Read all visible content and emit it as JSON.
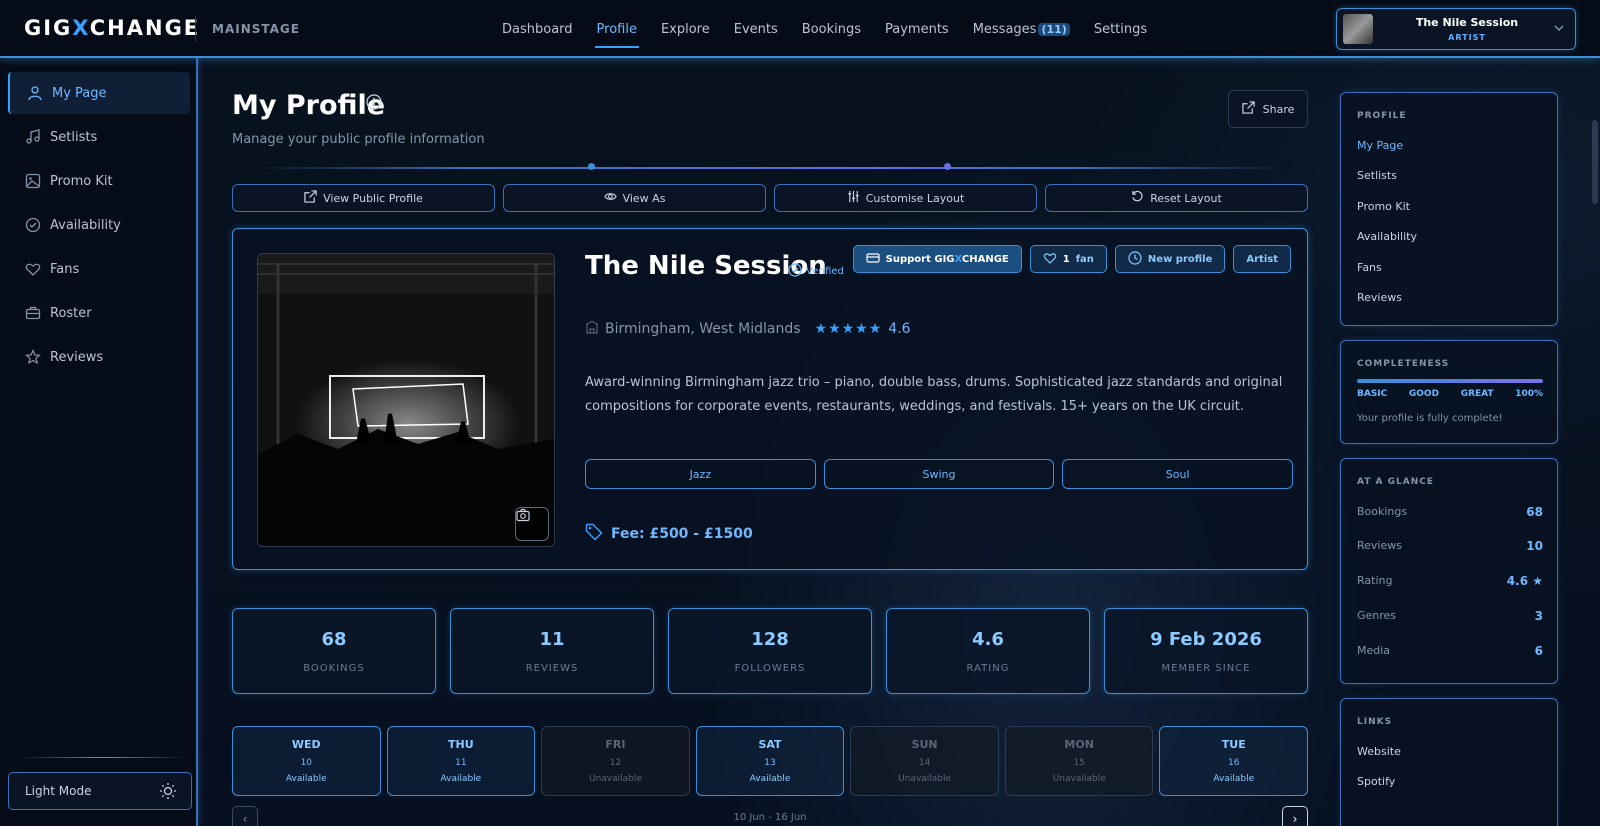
{
  "app": {
    "logo_pre": "GIG",
    "logo_x": "X",
    "logo_post": "CHANGE",
    "section": "MAINSTAGE"
  },
  "nav": [
    {
      "label": "Dashboard"
    },
    {
      "label": "Profile",
      "active": true
    },
    {
      "label": "Explore"
    },
    {
      "label": "Events"
    },
    {
      "label": "Bookings"
    },
    {
      "label": "Payments"
    },
    {
      "label": "Messages",
      "badge": "(11)"
    },
    {
      "label": "Settings"
    }
  ],
  "user": {
    "name": "The Nile Session",
    "role": "ARTIST"
  },
  "sidebar": {
    "items": [
      {
        "label": "My Page",
        "icon": "user-icon",
        "active": true
      },
      {
        "label": "Setlists",
        "icon": "music-note-icon"
      },
      {
        "label": "Promo Kit",
        "icon": "image-icon"
      },
      {
        "label": "Availability",
        "icon": "check-circle-icon"
      },
      {
        "label": "Fans",
        "icon": "heart-icon"
      },
      {
        "label": "Roster",
        "icon": "briefcase-icon"
      },
      {
        "label": "Reviews",
        "icon": "star-icon"
      }
    ],
    "light_mode_label": "Light Mode"
  },
  "page": {
    "title": "My Profile",
    "subtitle": "Manage your public profile information",
    "share_label": "Share"
  },
  "actions": {
    "view_public": "View Public Profile",
    "view_as": "View As",
    "customise": "Customise Layout",
    "reset": "Reset Layout"
  },
  "profile": {
    "name": "The Nile Session",
    "verified": "Verified",
    "support_pre": "Support GIG",
    "support_x": "X",
    "support_post": "CHANGE",
    "fans_count": "1",
    "fans_label": "fan",
    "new_profile": "New profile",
    "artist_tag": "Artist",
    "location": "Birmingham, West Midlands",
    "stars": "★★★★★",
    "rating": "4.6",
    "bio": "Award-winning Birmingham jazz trio – piano, double bass, drums. Sophisticated jazz standards and original compositions for corporate events, restaurants, weddings, and festivals. 15+ years on the UK circuit.",
    "genres": [
      "Jazz",
      "Swing",
      "Soul"
    ],
    "fee": "Fee: £500 - £1500"
  },
  "stats": [
    {
      "value": "68",
      "label": "BOOKINGS"
    },
    {
      "value": "11",
      "label": "REVIEWS"
    },
    {
      "value": "128",
      "label": "FOLLOWERS"
    },
    {
      "value": "4.6",
      "label": "RATING"
    },
    {
      "value": "9 Feb 2026",
      "label": "MEMBER SINCE"
    }
  ],
  "days": [
    {
      "day": "WED",
      "date": "10",
      "status": "Available",
      "available": true
    },
    {
      "day": "THU",
      "date": "11",
      "status": "Available",
      "available": true
    },
    {
      "day": "FRI",
      "date": "12",
      "status": "Unavailable",
      "available": false
    },
    {
      "day": "SAT",
      "date": "13",
      "status": "Available",
      "available": true
    },
    {
      "day": "SUN",
      "date": "14",
      "status": "Unavailable",
      "available": false
    },
    {
      "day": "MON",
      "date": "15",
      "status": "Unavailable",
      "available": false
    },
    {
      "day": "TUE",
      "date": "16",
      "status": "Available",
      "available": true
    }
  ],
  "week_range": "10 Jun - 16 Jun",
  "right_panel": {
    "profile_head": "PROFILE",
    "profile_links": [
      "My Page",
      "Setlists",
      "Promo Kit",
      "Availability",
      "Fans",
      "Reviews"
    ],
    "completeness_head": "COMPLETENESS",
    "levels": [
      "BASIC",
      "GOOD",
      "GREAT",
      "100%"
    ],
    "completeness_note": "Your profile is fully complete!",
    "glance_head": "AT A GLANCE",
    "glance": [
      {
        "k": "Bookings",
        "v": "68"
      },
      {
        "k": "Reviews",
        "v": "10"
      },
      {
        "k": "Rating",
        "v": "4.6 ★"
      },
      {
        "k": "Genres",
        "v": "3"
      },
      {
        "k": "Media",
        "v": "6"
      }
    ],
    "links_head": "LINKS",
    "links": [
      "Website",
      "Spotify"
    ]
  },
  "colors": {
    "accent": "#3aa0ff",
    "background": "#07101e",
    "border": "#3a8fd9"
  }
}
